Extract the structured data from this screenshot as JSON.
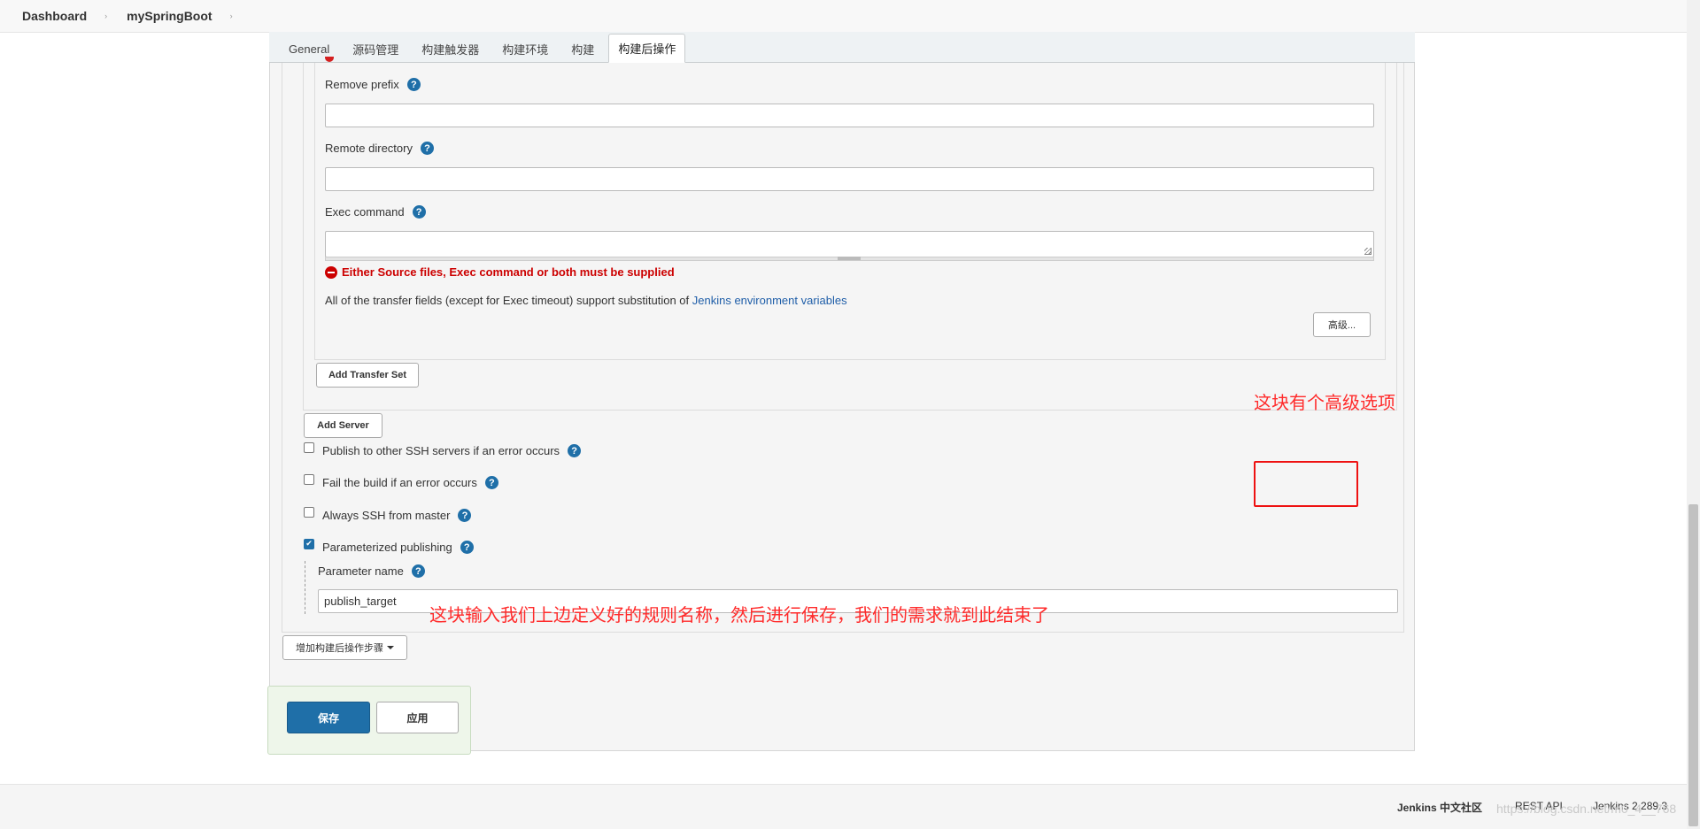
{
  "breadcrumb": {
    "items": [
      "Dashboard",
      "mySpringBoot"
    ],
    "separator": "›"
  },
  "tabs": [
    "General",
    "源码管理",
    "构建触发器",
    "构建环境",
    "构建",
    "构建后操作"
  ],
  "active_tab": "构建后操作",
  "fields": {
    "remove_prefix": {
      "label": "Remove prefix",
      "value": ""
    },
    "remote_directory": {
      "label": "Remote directory",
      "value": ""
    },
    "exec_command": {
      "label": "Exec command",
      "value": ""
    }
  },
  "help_glyph": "?",
  "error_message": "Either Source files, Exec command or both must be supplied",
  "note": {
    "text": "All of the transfer fields (except for Exec timeout) support substitution of ",
    "link": "Jenkins environment variables"
  },
  "buttons": {
    "advanced": "高级...",
    "add_transfer_set": "Add Transfer Set",
    "add_server": "Add Server",
    "add_post_build_step": "增加构建后操作步骤",
    "save": "保存",
    "apply": "应用"
  },
  "checkboxes": [
    {
      "label": "Publish to other SSH servers if an error occurs",
      "checked": false
    },
    {
      "label": "Fail the build if an error occurs",
      "checked": false
    },
    {
      "label": "Always SSH from master",
      "checked": false
    },
    {
      "label": "Parameterized publishing",
      "checked": true
    }
  ],
  "parameter": {
    "label": "Parameter name",
    "value": "publish_target"
  },
  "annotations": {
    "advanced_hint": "这块有个高级选项",
    "param_hint": "这块输入我们上边定义好的规则名称，然后进行保存，我们的需求就到此结束了"
  },
  "footer": {
    "community": "Jenkins 中文社区",
    "rest_api": "REST API",
    "version": "Jenkins 2.289.3"
  },
  "watermark": "https://blog.csdn.net/m0_4__768",
  "colors": {
    "primary": "#1f6fa8",
    "error": "#cc0000",
    "annotation": "#ff2a2a",
    "link": "#1f5ea8"
  }
}
